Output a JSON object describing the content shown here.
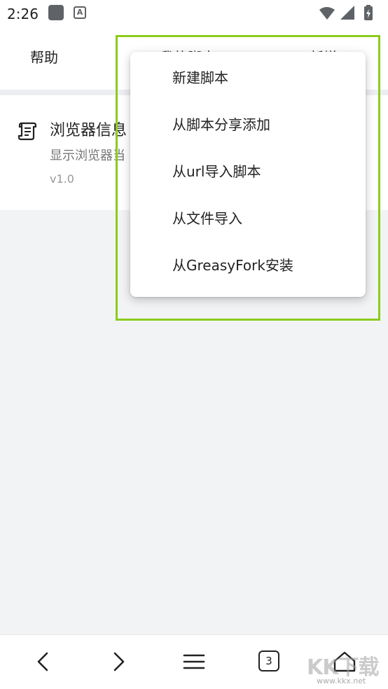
{
  "status_bar": {
    "time": "2:26",
    "app_badge": "A",
    "icons": [
      "wifi-icon",
      "signal-icon",
      "battery-charging-icon"
    ]
  },
  "top_tabs": {
    "help": "帮助",
    "mine": "我的脚本",
    "new": "新增"
  },
  "script_list": [
    {
      "icon": "scroll-icon",
      "title": "浏览器信息",
      "description": "显示浏览器当",
      "version": "v1.0"
    }
  ],
  "add_menu": {
    "items": [
      {
        "label": "新建脚本"
      },
      {
        "label": "从脚本分享添加"
      },
      {
        "label": "从url导入脚本"
      },
      {
        "label": "从文件导入"
      },
      {
        "label": "从GreasyFork安装"
      }
    ]
  },
  "highlight_color": "#8ccc1c",
  "bottom_nav": {
    "tab_count": "3",
    "icons": [
      "back-icon",
      "forward-icon",
      "menu-icon",
      "tabs-icon",
      "home-icon"
    ]
  },
  "watermark": {
    "text": "KK下载",
    "url": "www.kkx.net"
  }
}
